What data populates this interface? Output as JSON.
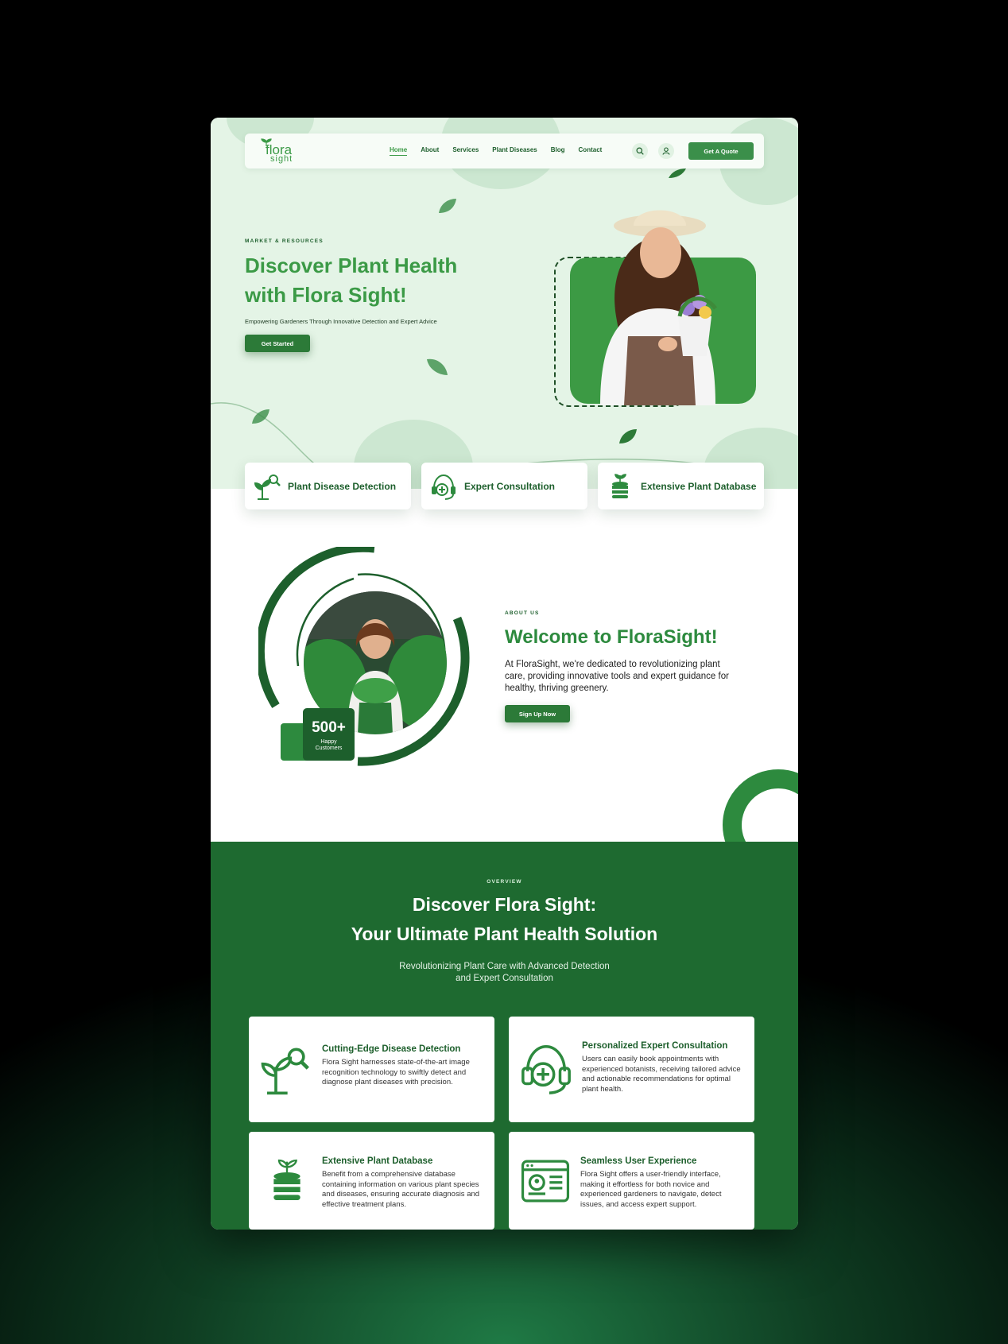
{
  "brand": {
    "logo_line1": "flora",
    "logo_line2": "sight"
  },
  "nav": {
    "items": [
      "Home",
      "About",
      "Services",
      "Plant Diseases",
      "Blog",
      "Contact"
    ],
    "quote_button": "Get A Quote"
  },
  "hero": {
    "eyebrow": "MARKET & RESOURCES",
    "title": "Discover Plant Health with Flora Sight!",
    "subtitle": "Empowering Gardeners Through Innovative Detection and Expert Advice",
    "cta": "Get Started"
  },
  "features": [
    {
      "label": "Plant Disease Detection",
      "icon": "plant-search-icon"
    },
    {
      "label": "Expert Consultation",
      "icon": "headset-medical-icon"
    },
    {
      "label": "Extensive Plant Database",
      "icon": "plant-database-icon"
    }
  ],
  "about": {
    "eyebrow": "ABOUT US",
    "title": "Welcome to FloraSight!",
    "text": "At FloraSight, we're dedicated to revolutionizing plant care, providing innovative tools and expert guidance for healthy, thriving greenery.",
    "cta": "Sign Up Now",
    "badge_value": "500+",
    "badge_label": "Happy Customers"
  },
  "overview": {
    "eyebrow": "OVERVIEW",
    "title_line1": "Discover Flora Sight:",
    "title_line2": "Your Ultimate Plant Health Solution",
    "sub_line1": "Revolutionizing Plant Care with Advanced Detection",
    "sub_line2": "and Expert Consultation",
    "cards": [
      {
        "title": "Cutting-Edge Disease Detection",
        "text": "Flora Sight harnesses state-of-the-art image recognition technology to swiftly detect and diagnose plant diseases with precision.",
        "icon": "plant-search-icon"
      },
      {
        "title": "Personalized Expert Consultation",
        "text": "Users can easily book appointments with experienced botanists, receiving tailored advice and actionable recommendations for optimal plant health.",
        "icon": "headset-medical-icon"
      },
      {
        "title": "Extensive Plant Database",
        "text": "Benefit from a comprehensive database containing information on various plant species and diseases, ensuring accurate diagnosis and effective treatment plans.",
        "icon": "plant-database-icon"
      },
      {
        "title": "Seamless User Experience",
        "text": "Flora Sight offers a user-friendly interface, making it effortless for both novice and experienced gardeners to navigate, detect issues, and access expert support.",
        "icon": "browser-profile-icon"
      }
    ]
  },
  "colors": {
    "primary": "#2d8a3e",
    "dark": "#1d5f2c",
    "hero_bg": "#e4f4e6",
    "overview_bg": "#1e6a30"
  }
}
